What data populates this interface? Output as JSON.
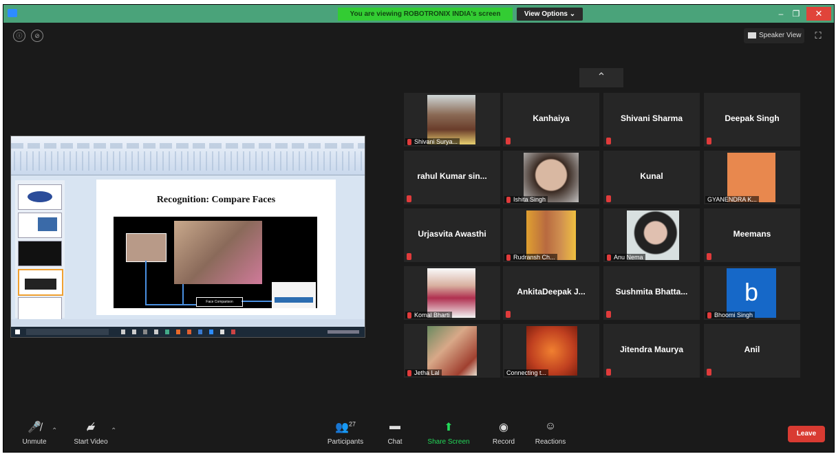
{
  "titlebar": {
    "banner": "You are viewing ROBOTRONIX INDIA's screen",
    "view_options": "View Options ⌄",
    "minimize": "–",
    "maximize": "❐",
    "close": "✕"
  },
  "top": {
    "info_icon": "ⓘ",
    "shield_icon": "⊘",
    "speaker_view": "Speaker View",
    "fullscreen": "⛶"
  },
  "shared_screen": {
    "slide_title": "Recognition: Compare Faces",
    "face_comparison": "Face Comparison"
  },
  "gallery": {
    "page_up": "⌃",
    "tiles": [
      {
        "name": "",
        "label": "Shivani Surya..."
      },
      {
        "name": "Kanhaiya",
        "label": ""
      },
      {
        "name": "Shivani Sharma",
        "label": ""
      },
      {
        "name": "Deepak Singh",
        "label": ""
      },
      {
        "name": "rahul Kumar sin...",
        "label": ""
      },
      {
        "name": "",
        "label": "Ishita Singh"
      },
      {
        "name": "Kunal",
        "label": ""
      },
      {
        "name": "",
        "label": "GYANENDRA K..."
      },
      {
        "name": "Urjasvita Awasthi",
        "label": ""
      },
      {
        "name": "",
        "label": "Rudransh Ch..."
      },
      {
        "name": "",
        "label": "Anu Nema"
      },
      {
        "name": "Meemans",
        "label": ""
      },
      {
        "name": "",
        "label": "Komal Bharti"
      },
      {
        "name": "AnkitaDeepak J...",
        "label": ""
      },
      {
        "name": "Sushmita Bhatta...",
        "label": ""
      },
      {
        "name": "",
        "label": "Bhoomi Singh",
        "avatar_letter": "b"
      },
      {
        "name": "",
        "label": "Jetha Lal"
      },
      {
        "name": "",
        "label": "Connecting t..."
      },
      {
        "name": "Jitendra Maurya",
        "label": ""
      },
      {
        "name": "Anil",
        "label": ""
      }
    ]
  },
  "toolbar": {
    "unmute": "Unmute",
    "start_video": "Start Video",
    "participants": "Participants",
    "participants_count": "27",
    "chat": "Chat",
    "share_screen": "Share Screen",
    "record": "Record",
    "reactions": "Reactions",
    "leave": "Leave"
  },
  "colors": {
    "titlebar": "#4aa37a",
    "banner": "#33cc33",
    "leave": "#d93b32",
    "share_screen": "#23d959",
    "tile": "#262626"
  }
}
